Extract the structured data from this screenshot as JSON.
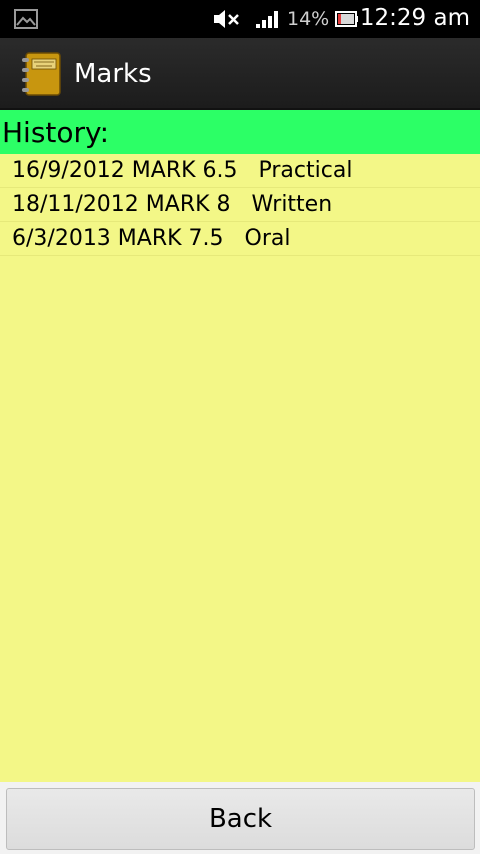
{
  "status_bar": {
    "battery_percent": "14%",
    "time": "12:29 am"
  },
  "action_bar": {
    "title": "Marks"
  },
  "history": {
    "header": "History:",
    "entries": [
      "16/9/2012 MARK 6.5   Practical",
      "18/11/2012 MARK 8   Written",
      "6/3/2013 MARK 7.5   Oral"
    ]
  },
  "footer": {
    "back_label": "Back"
  },
  "colors": {
    "content_bg": "#f3f787",
    "header_bg": "#2cff66",
    "action_bar_bg": "#222222"
  },
  "icons": {
    "status": [
      "gallery-icon",
      "mute-icon",
      "signal-icon",
      "battery-icon"
    ],
    "app": "notebook-icon"
  }
}
